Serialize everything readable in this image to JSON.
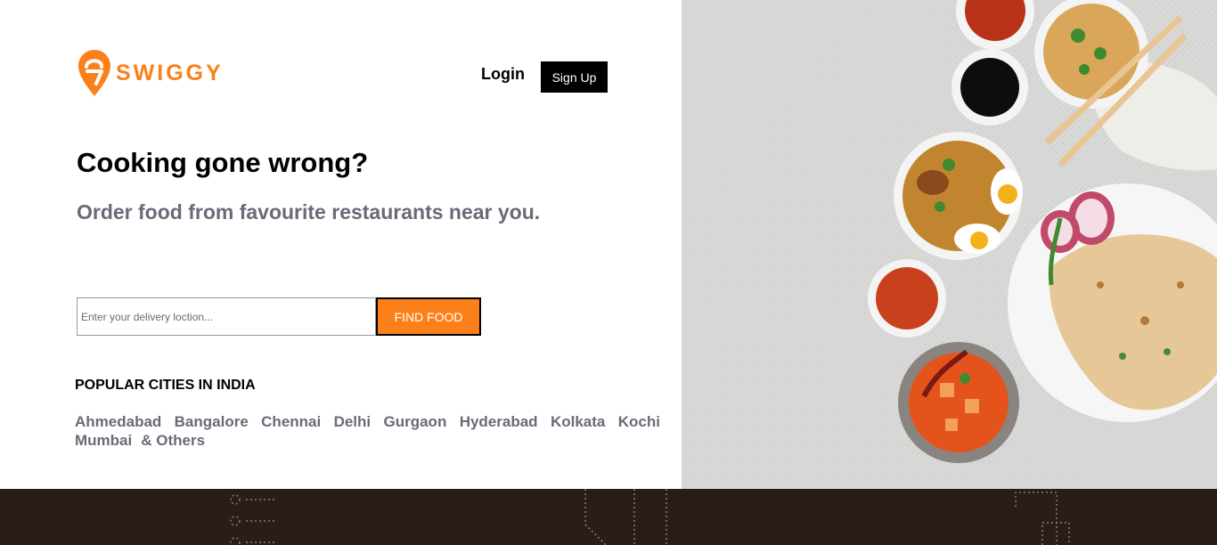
{
  "brand": {
    "name": "SWIGGY",
    "accent": "#fc8019"
  },
  "nav": {
    "login": "Login",
    "signup": "Sign Up"
  },
  "hero": {
    "headline": "Cooking gone wrong?",
    "subhead": "Order food from favourite restaurants near you."
  },
  "search": {
    "placeholder": "Enter your delivery loction...",
    "value": "",
    "button": "FIND FOOD"
  },
  "cities": {
    "title": "POPULAR CITIES IN INDIA",
    "row1": [
      "Ahmedabad",
      "Bangalore",
      "Chennai",
      "Delhi",
      "Gurgaon",
      "Hyderabad",
      "Kolkata",
      "Kochi"
    ],
    "row2": [
      "Mumbai",
      "& Others"
    ]
  },
  "colors": {
    "footer": "#2a1d18",
    "hero_bg": "#dcdcdc",
    "muted_text": "#686b78"
  },
  "image": {
    "subject": "food-platters-photo"
  }
}
